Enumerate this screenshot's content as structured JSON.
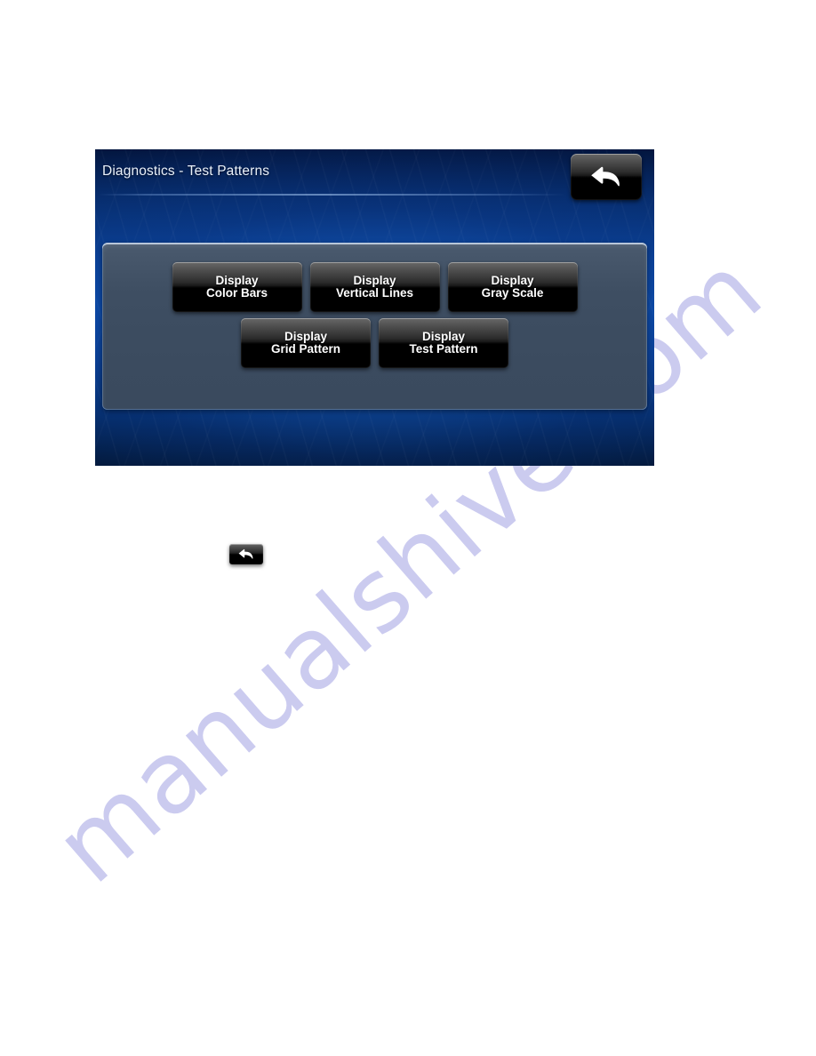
{
  "document": {
    "background_color": "#ffffff",
    "watermark": {
      "text": "manualshive.com",
      "color": "#c9c9ef"
    }
  },
  "screen": {
    "title": "Diagnostics - Test Patterns",
    "background_color": "#0b4ba8",
    "panel_color": "#3e4e62",
    "header": {
      "back_button": {
        "icon": "back-arrow-icon",
        "label": ""
      }
    },
    "buttons": {
      "rows": [
        [
          {
            "line1": "Display",
            "line2": "Color Bars",
            "name": "display-color-bars-button"
          },
          {
            "line1": "Display",
            "line2": "Vertical Lines",
            "name": "display-vertical-lines-button"
          },
          {
            "line1": "Display",
            "line2": "Gray Scale",
            "name": "display-gray-scale-button"
          }
        ],
        [
          {
            "line1": "Display",
            "line2": "Grid Pattern",
            "name": "display-grid-pattern-button"
          },
          {
            "line1": "Display",
            "line2": "Test Pattern",
            "name": "display-test-pattern-button"
          }
        ]
      ]
    }
  },
  "caption": {
    "back_icon": {
      "icon": "back-arrow-icon"
    }
  }
}
